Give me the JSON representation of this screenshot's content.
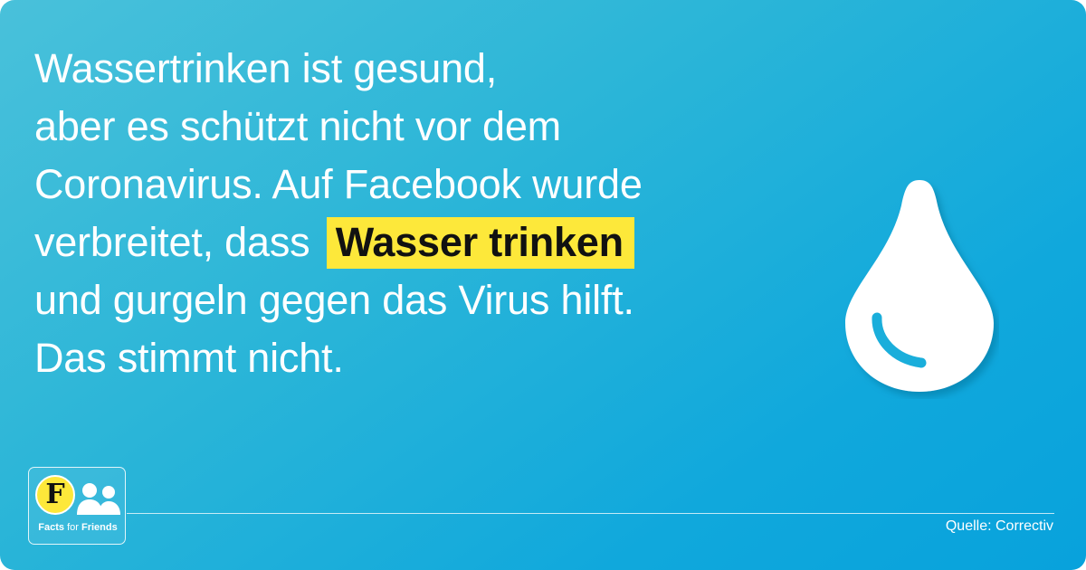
{
  "headline": {
    "line1": "Wassertrinken ist gesund,",
    "line2": "aber es schützt nicht vor dem",
    "line3": "Coronavirus. Auf Facebook wurde",
    "line4_pre": "verbreitet, dass",
    "highlight": "Wasser trinken",
    "line5": "und gurgeln gegen das Virus hilft.",
    "line6": "Das stimmt nicht."
  },
  "illustration": {
    "icon": "water-drop-icon"
  },
  "logo": {
    "letter": "F",
    "word_facts": "Facts",
    "word_for": "for",
    "word_friends": "Friends",
    "icon": "people-icon"
  },
  "footer": {
    "source": "Quelle: Correctiv"
  },
  "colors": {
    "background_start": "#49c1da",
    "background_end": "#08a2dc",
    "highlight": "#fde83a",
    "text": "#ffffff"
  }
}
